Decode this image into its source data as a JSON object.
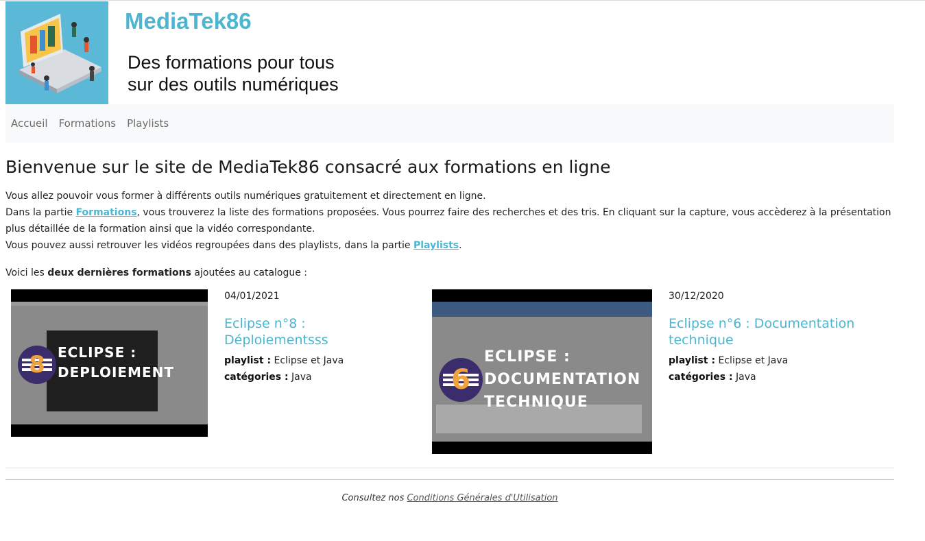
{
  "header": {
    "site_title": "MediaTek86",
    "tagline_line1": "Des formations pour tous",
    "tagline_line2": "sur des outils numériques",
    "logo_icon": "laptop-people-illustration"
  },
  "nav": {
    "items": [
      {
        "label": "Accueil"
      },
      {
        "label": "Formations"
      },
      {
        "label": "Playlists"
      }
    ]
  },
  "main": {
    "heading": "Bienvenue sur le site de MediaTek86 consacré aux formations en ligne",
    "p1": "Vous allez pouvoir vous former à différents outils numériques gratuitement et directement en ligne.",
    "p2_before": "Dans la partie ",
    "p2_link": "Formations",
    "p2_after": ", vous trouverez la liste des formations proposées. Vous pourrez faire des recherches et des tris. En cliquant sur la capture, vous accèderez à la présentation plus détaillée de la formation ainsi que la vidéo correspondante.",
    "p3_before": "Vous pouvez aussi retrouver les vidéos regroupées dans des playlists, dans la partie ",
    "p3_link": "Playlists",
    "p3_after": ".",
    "latest_before": "Voici les ",
    "latest_bold": "deux dernières formations",
    "latest_after": " ajoutées au catalogue :"
  },
  "formations": [
    {
      "date": "04/01/2021",
      "title": "Eclipse n°8 : Déploiementsss",
      "playlist_label": "playlist :",
      "playlist": "Eclipse et Java",
      "categories_label": "catégories :",
      "categories": "Java",
      "thumb_number": "8",
      "thumb_caption_1": "ECLIPSE :",
      "thumb_caption_2": "DEPLOIEMENT"
    },
    {
      "date": "30/12/2020",
      "title": "Eclipse n°6 : Documentation technique",
      "playlist_label": "playlist :",
      "playlist": "Eclipse et Java",
      "categories_label": "catégories :",
      "categories": "Java",
      "thumb_number": "6",
      "thumb_caption_1": "ECLIPSE :",
      "thumb_caption_2": "DOCUMENTATION",
      "thumb_caption_3": "TECHNIQUE"
    }
  ],
  "footer": {
    "text": "Consultez nos ",
    "link": "Conditions Générales d'Utilisation"
  },
  "colors": {
    "accent": "#4cb6d1",
    "nav_bg": "#f8f9fa",
    "logo_bg": "#5bb8d6"
  }
}
